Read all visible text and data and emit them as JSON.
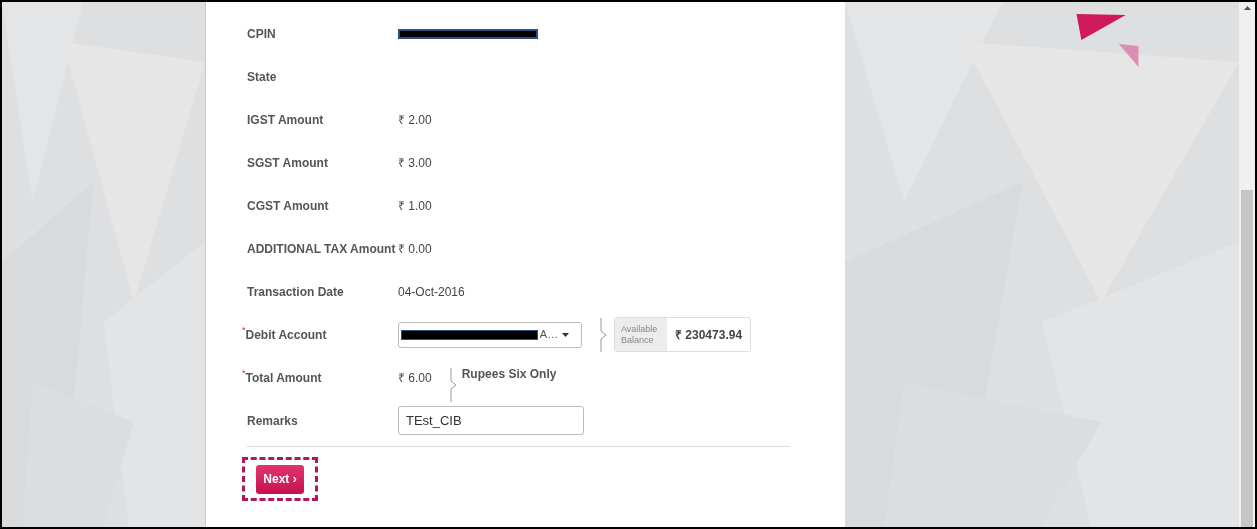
{
  "form": {
    "rows": [
      {
        "kind": "redacted",
        "label": "CPIN"
      },
      {
        "kind": "text",
        "label": "State"
      },
      {
        "kind": "text",
        "label": "IGST Amount",
        "value": "₹ 2.00"
      },
      {
        "kind": "text",
        "label": "SGST Amount",
        "value": "₹ 3.00"
      },
      {
        "kind": "text",
        "label": "CGST Amount",
        "value": "₹ 1.00"
      },
      {
        "kind": "text",
        "label": "ADDITIONAL TAX Amount",
        "value": "₹ 0.00"
      },
      {
        "kind": "text",
        "label": "Transaction Date",
        "value": "04-Oct-2016"
      },
      {
        "kind": "select",
        "label": "Debit Account",
        "required_mark": "*",
        "value": "A…",
        "aside": {
          "kind": "balance",
          "label": "Available Balance",
          "value": "₹ 230473.94"
        }
      },
      {
        "kind": "text",
        "label": "Total Amount",
        "required_mark": "*",
        "value": "₹ 6.00",
        "aside": {
          "kind": "words",
          "value": "Rupees Six Only"
        }
      },
      {
        "kind": "input",
        "label": "Remarks",
        "value": "TEst_CIB"
      }
    ]
  },
  "next_button": {
    "label": "Next ›",
    "highlighted": true
  }
}
